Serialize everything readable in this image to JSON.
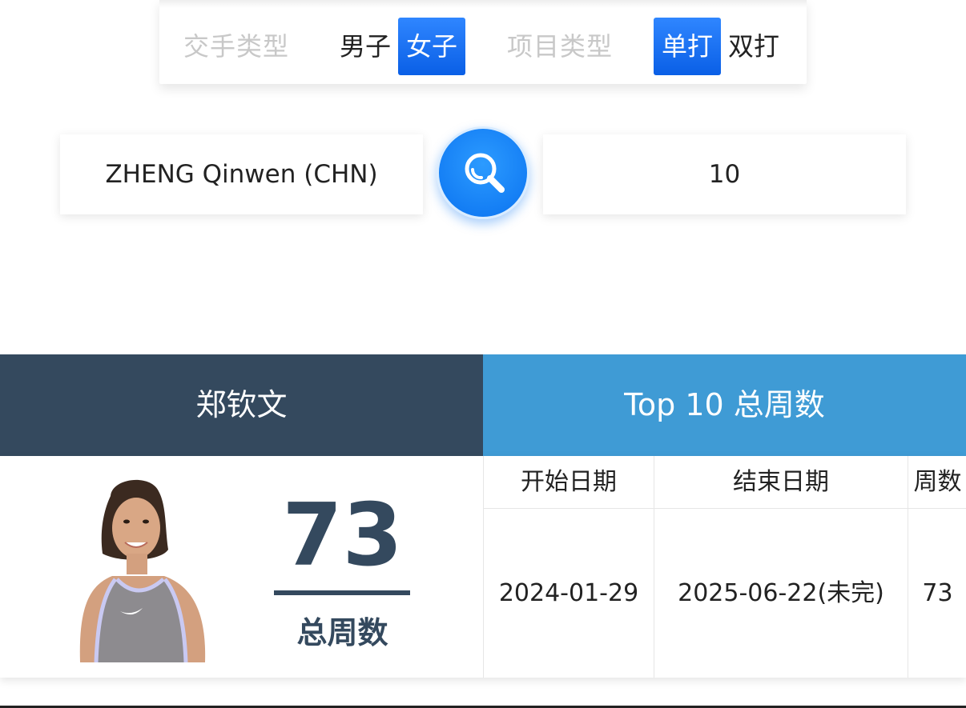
{
  "filters": {
    "match_type_label": "交手类型",
    "men_label": "男子",
    "women_label": "女子",
    "event_type_label": "项目类型",
    "singles_label": "单打",
    "doubles_label": "双打",
    "selected_gender": "女子",
    "selected_event": "单打"
  },
  "search": {
    "player_value": "ZHENG Qinwen (CHN)",
    "top_n_value": "10",
    "button_icon": "search-icon"
  },
  "header": {
    "player_name": "郑钦文",
    "stat_title": "Top 10 总周数"
  },
  "summary": {
    "total_weeks": "73",
    "total_weeks_caption": "总周数"
  },
  "table": {
    "headers": [
      "开始日期",
      "结束日期",
      "周数"
    ],
    "rows": [
      [
        "2024-01-29",
        "2025-06-22(未完)",
        "73"
      ]
    ]
  },
  "colors": {
    "accent_blue": "#0a6cf0",
    "header_dark": "#34495e",
    "header_light": "#3f9bd5"
  }
}
